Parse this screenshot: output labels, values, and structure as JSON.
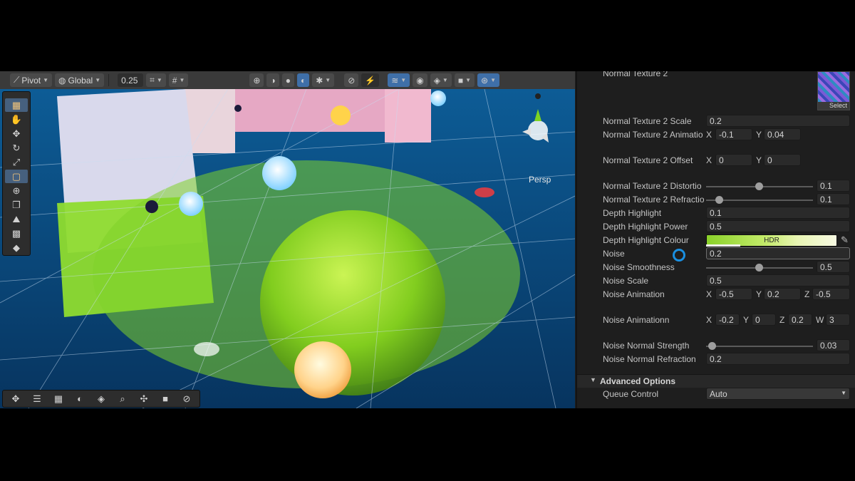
{
  "toolbar": {
    "pivot_label": "Pivot",
    "global_label": "Global",
    "snap_value": "0.25"
  },
  "scene": {
    "persp_label": "Persp",
    "left_tools": [
      "grid-tool-icon",
      "hand-icon",
      "move-icon",
      "rotate-icon",
      "scale-icon",
      "rect-tool-icon",
      "transform-icon",
      "custom-tool-icon",
      "terrain-icon",
      "grid-paint-icon",
      "cube-icon"
    ],
    "bottom_tools": [
      "move-icon",
      "align-icon",
      "grid-snap-icon",
      "shading-icon",
      "layers-icon",
      "search-icon",
      "pivot-icon",
      "camera-icon",
      "compass-icon"
    ]
  },
  "inspector": {
    "normal_texture_2": {
      "label": "Normal Texture 2",
      "select_label": "Select"
    },
    "normal_texture_2_scale": {
      "label": "Normal Texture 2 Scale",
      "value": "0.2"
    },
    "normal_texture_2_animation": {
      "label": "Normal Texture 2 Animatio",
      "x_label": "X",
      "x": "-0.1",
      "y_label": "Y",
      "y": "0.04"
    },
    "normal_texture_2_offset": {
      "label": "Normal Texture 2 Offset",
      "x_label": "X",
      "x": "0",
      "y_label": "Y",
      "y": "0"
    },
    "normal_texture_2_distortion": {
      "label": "Normal Texture 2 Distortio",
      "value": "0.1",
      "fraction": 0.5
    },
    "normal_texture_2_refraction": {
      "label": "Normal Texture 2 Refractio",
      "value": "0.1",
      "fraction": 0.1
    },
    "depth_highlight": {
      "label": "Depth Highlight",
      "value": "0.1"
    },
    "depth_highlight_power": {
      "label": "Depth Highlight Power",
      "value": "0.5"
    },
    "depth_highlight_colour": {
      "label": "Depth Highlight Colour",
      "hdr_label": "HDR"
    },
    "noise": {
      "label": "Noise",
      "value": "0.2"
    },
    "noise_smoothness": {
      "label": "Noise Smoothness",
      "value": "0.5",
      "fraction": 0.5
    },
    "noise_scale": {
      "label": "Noise Scale",
      "value": "0.5"
    },
    "noise_animation": {
      "label": "Noise Animation",
      "x_label": "X",
      "x": "-0.5",
      "y_label": "Y",
      "y": "0.2",
      "z_label": "Z",
      "z": "-0.5"
    },
    "noise_animationn": {
      "label": "Noise Animationn",
      "x_label": "X",
      "x": "-0.2",
      "y_label": "Y",
      "y": "0",
      "z_label": "Z",
      "z": "0.2",
      "w_label": "W",
      "w": "3"
    },
    "noise_normal_strength": {
      "label": "Noise Normal Strength",
      "value": "0.03",
      "fraction": 0.05
    },
    "noise_normal_refraction": {
      "label": "Noise Normal Refraction",
      "value": "0.2"
    },
    "advanced_options": {
      "label": "Advanced Options"
    },
    "queue_control": {
      "label": "Queue Control",
      "value": "Auto"
    }
  },
  "colors": {
    "accent": "#3f6fa8",
    "hdr_color": "#9be03a",
    "cursor": "#1a8fe0"
  }
}
